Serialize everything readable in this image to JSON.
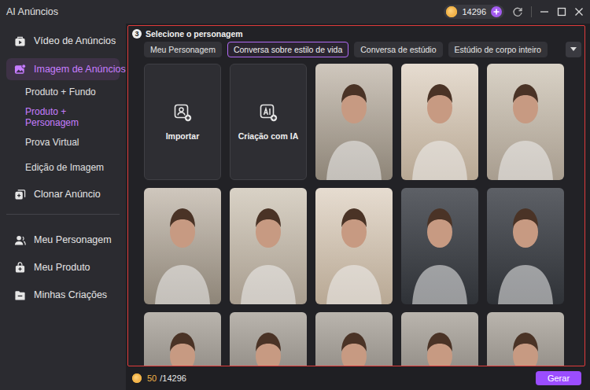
{
  "window": {
    "title": "AI Anúncios",
    "credits": "14296"
  },
  "sidebar": {
    "groups": [
      [
        {
          "label": "Vídeo de Anúncios",
          "selected": false,
          "expanded": false,
          "children": []
        },
        {
          "label": "Imagem de Anúncios",
          "selected": true,
          "expanded": true,
          "children": [
            {
              "label": "Produto + Fundo",
              "selected": false
            },
            {
              "label": "Produto + Personagem",
              "selected": true
            },
            {
              "label": "Prova Virtual",
              "selected": false
            },
            {
              "label": "Edição de Imagem",
              "selected": false
            }
          ]
        },
        {
          "label": "Clonar Anúncio",
          "selected": false,
          "expanded": false,
          "children": []
        }
      ],
      [
        {
          "label": "Meu Personagem",
          "selected": false,
          "expanded": false,
          "children": []
        },
        {
          "label": "Meu Produto",
          "selected": false,
          "expanded": false,
          "children": []
        },
        {
          "label": "Minhas Criações",
          "selected": false,
          "expanded": false,
          "children": []
        }
      ]
    ]
  },
  "panel": {
    "step": "3",
    "title": "Selecione o personagem",
    "tabs": [
      {
        "label": "Meu Personagem",
        "selected": false
      },
      {
        "label": "Conversa sobre estilo de vida",
        "selected": true
      },
      {
        "label": "Conversa de estúdio",
        "selected": false
      },
      {
        "label": "Estúdio de corpo inteiro",
        "selected": false
      }
    ],
    "cards": [
      {
        "kind": "import",
        "label": "Importar"
      },
      {
        "kind": "ai",
        "label": "Criação com IA"
      },
      {
        "kind": "photo"
      },
      {
        "kind": "photo"
      },
      {
        "kind": "photo"
      },
      {
        "kind": "photo"
      },
      {
        "kind": "photo"
      },
      {
        "kind": "photo"
      },
      {
        "kind": "photo"
      },
      {
        "kind": "photo"
      },
      {
        "kind": "photo"
      },
      {
        "kind": "photo"
      },
      {
        "kind": "photo"
      },
      {
        "kind": "photo"
      },
      {
        "kind": "photo"
      }
    ]
  },
  "footer": {
    "cost": "50",
    "balance": "/14296",
    "button": "Gerar"
  }
}
